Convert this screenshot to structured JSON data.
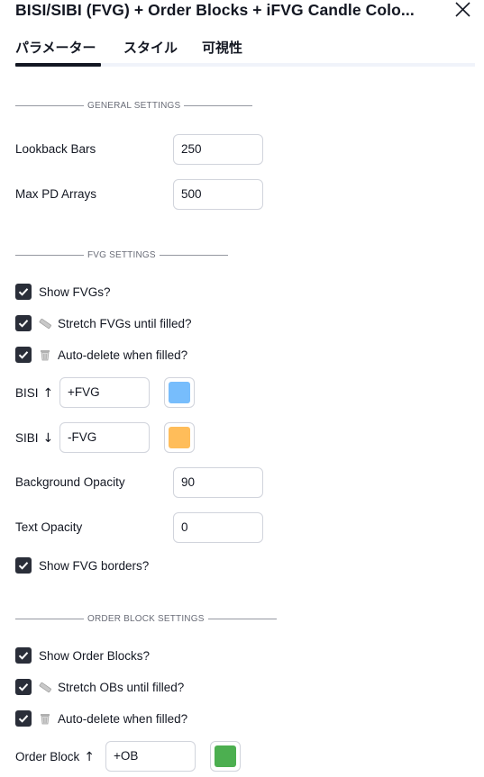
{
  "header": {
    "title": "BISI/SIBI (FVG) + Order Blocks + iFVG Candle Colo...",
    "close_icon": "close-icon"
  },
  "tabs": [
    {
      "label": "パラメーター",
      "active": true
    },
    {
      "label": "スタイル",
      "active": false
    },
    {
      "label": "可視性",
      "active": false
    }
  ],
  "general": {
    "section_title": "GENERAL SETTINGS",
    "lookback_label": "Lookback Bars",
    "lookback_value": "250",
    "max_pd_label": "Max PD Arrays",
    "max_pd_value": "500"
  },
  "fvg": {
    "section_title": "FVG SETTINGS",
    "show_fvgs": {
      "label": "Show FVGs?",
      "checked": true
    },
    "stretch_fvgs": {
      "label": "Stretch FVGs until filled?",
      "checked": true,
      "icon": "ruler-icon"
    },
    "auto_delete": {
      "label": "Auto-delete when filled?",
      "checked": true,
      "icon": "wastebasket-icon"
    },
    "bisi_label": "BISI",
    "bisi_arrow": "↑",
    "bisi_value": "+FVG",
    "bisi_color": "#77bdfc",
    "sibi_label": "SIBI",
    "sibi_arrow": "↓",
    "sibi_value": "-FVG",
    "sibi_color": "#ffbd5a",
    "bg_opacity_label": "Background Opacity",
    "bg_opacity_value": "90",
    "text_opacity_label": "Text Opacity",
    "text_opacity_value": "0",
    "show_borders": {
      "label": "Show FVG borders?",
      "checked": true
    }
  },
  "order_blocks": {
    "section_title": "ORDER BLOCK SETTINGS",
    "show_obs": {
      "label": "Show Order Blocks?",
      "checked": true
    },
    "stretch_obs": {
      "label": "Stretch OBs until filled?",
      "checked": true,
      "icon": "ruler-icon"
    },
    "auto_delete": {
      "label": "Auto-delete when filled?",
      "checked": true,
      "icon": "wastebasket-icon"
    },
    "ob_label": "Order Block",
    "ob_arrow": "↑",
    "ob_value": "+OB",
    "ob_color": "#4caf50"
  }
}
